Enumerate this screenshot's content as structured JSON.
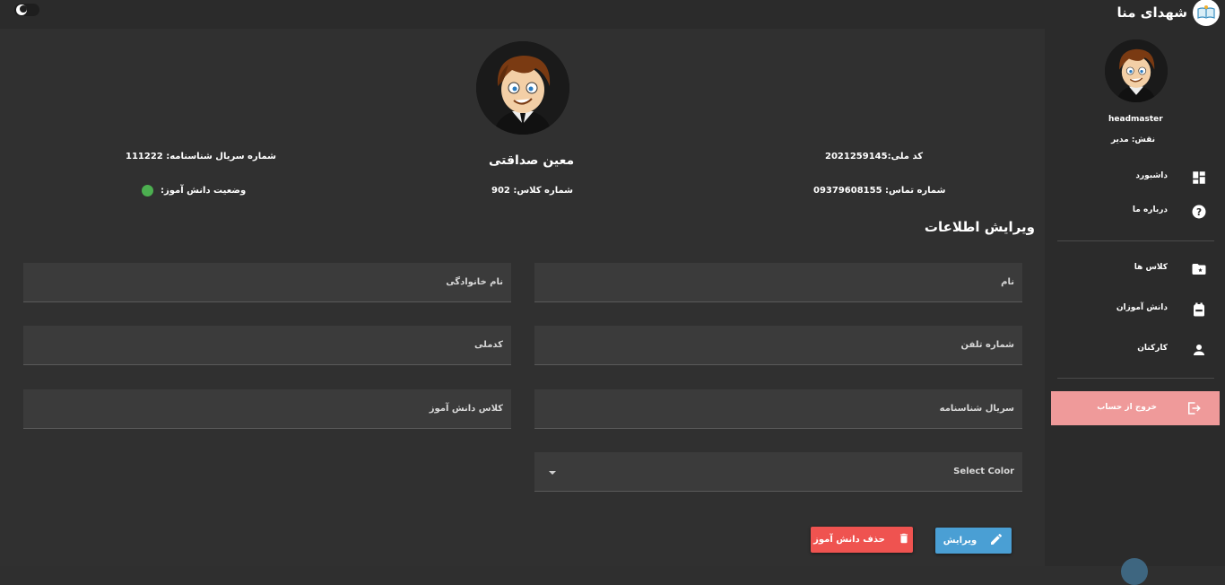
{
  "header": {
    "brand_title": "شهدای منا",
    "logo_icon": "book-logo-icon",
    "theme_toggle_icon": "moon-icon"
  },
  "profile": {
    "full_name": "معین صداقتی",
    "national_code": "کد ملی:2021259145",
    "phone": "شماره تماس: 09379608155",
    "class_number": "شماره کلاس: 902",
    "id_serial": "شماره سریال شناسنامه: 111222",
    "student_status_label": "وضعیت دانش آموز:",
    "student_status_color": "#4caf50"
  },
  "form": {
    "title": "ویرایش اطلاعات",
    "first_name_placeholder": "نام",
    "last_name_placeholder": "نام خانوادگی",
    "phone_placeholder": "شماره تلفن",
    "national_code_placeholder": "کدملی",
    "id_serial_placeholder": "سریال شناسنامه",
    "class_placeholder": "کلاس دانش آموز",
    "color_select_placeholder": "Select Color",
    "edit_button": "ویرایش",
    "delete_button": "حذف دانش آموز"
  },
  "sidebar": {
    "username": "headmaster",
    "role": "نقش: مدیر",
    "items": [
      {
        "label": "داشبورد",
        "icon": "dashboard-icon"
      },
      {
        "label": "درباره ما",
        "icon": "help-icon"
      },
      {
        "label": "کلاس ها",
        "icon": "folder-star-icon"
      },
      {
        "label": "دانش آموزان",
        "icon": "backpack-icon"
      },
      {
        "label": "کارکنان",
        "icon": "person-icon"
      }
    ],
    "logout_label": "خروج از حساب",
    "logout_icon": "logout-icon"
  },
  "colors": {
    "background": "#303030",
    "sidebar": "#2b2b2b",
    "edit_button": "#4a9fd4",
    "delete_button": "#ef5350",
    "logout": "#ef9a9a"
  }
}
